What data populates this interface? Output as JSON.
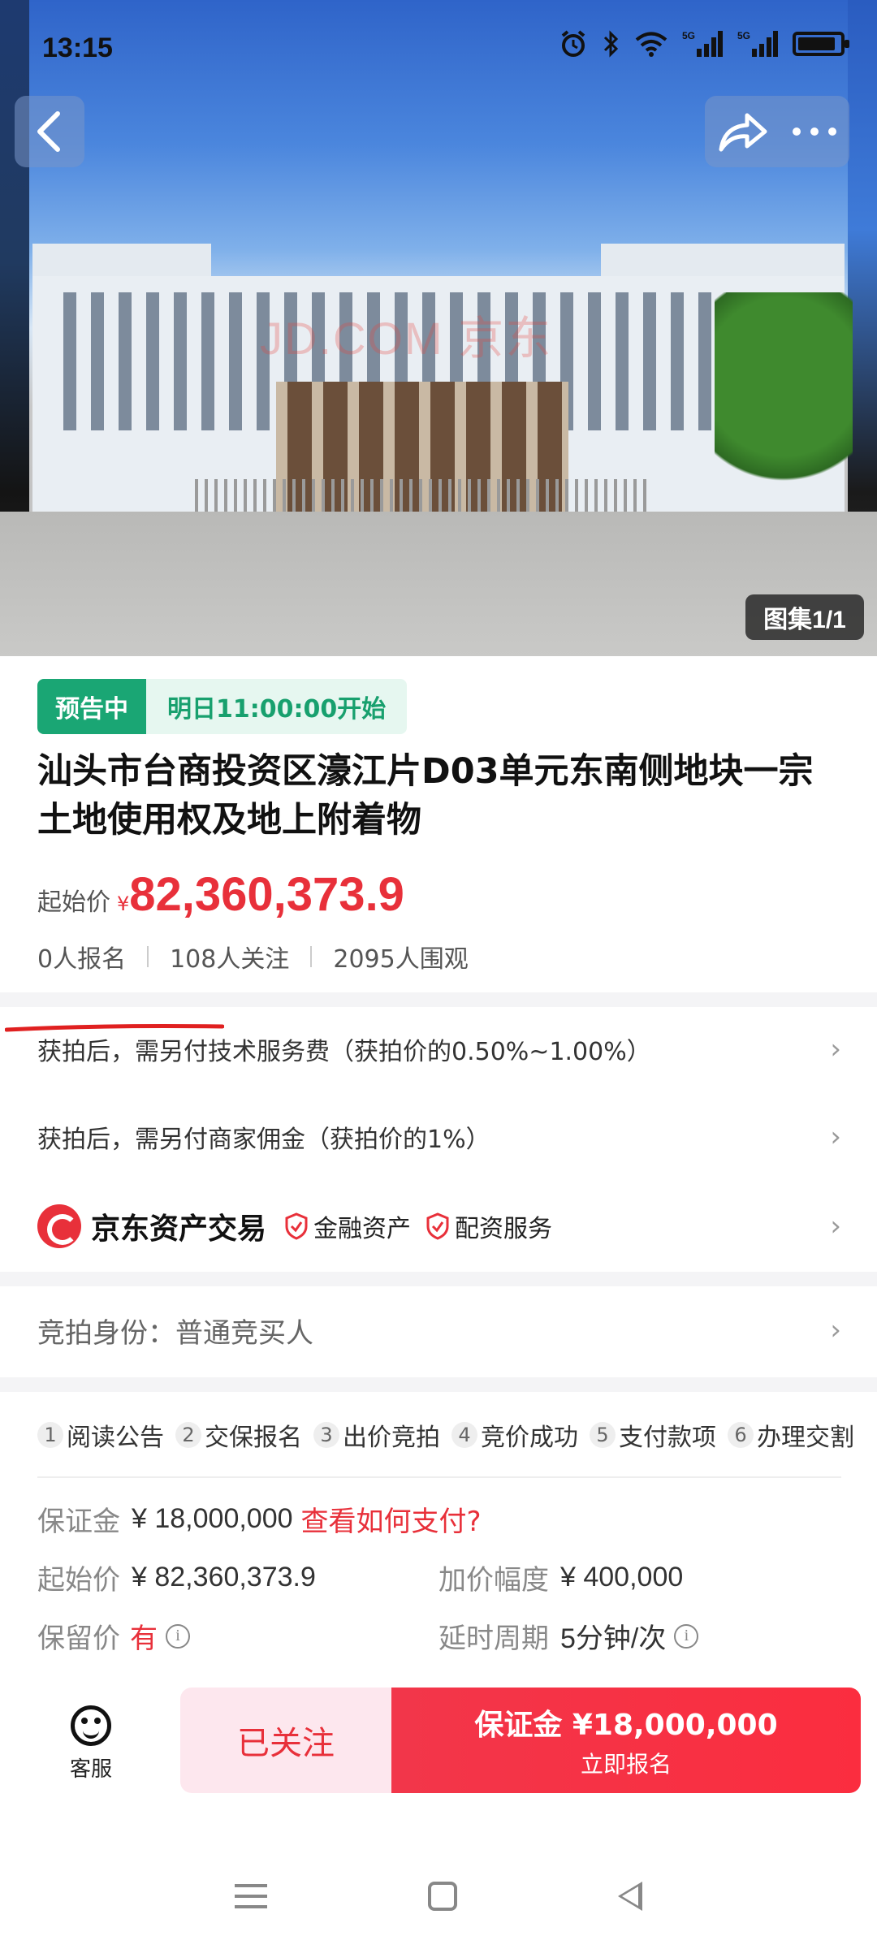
{
  "status_bar": {
    "time": "13:15",
    "battery_level": 0.9
  },
  "gallery": {
    "badge": "图集1/1",
    "watermark": "JD.COM 京东"
  },
  "auction": {
    "status_tag": "预告中",
    "start_time": "明日11:00:00开始",
    "title": "汕头市台商投资区濠江片D03单元东南侧地块一宗土地使用权及地上附着物",
    "price_label": "起始价",
    "price_currency": "¥",
    "price_value": "82,360,373.9",
    "stats": [
      "0人报名",
      "108人关注",
      "2095人围观"
    ]
  },
  "fees": [
    "获拍后，需另付技术服务费（获拍价的0.50%~1.00%）",
    "获拍后，需另付商家佣金（获拍价的1%）"
  ],
  "brand": {
    "name": "京东资产交易",
    "badges": [
      "金融资产",
      "配资服务"
    ]
  },
  "identity": {
    "text": "竞拍身份：普通竞买人"
  },
  "steps": [
    {
      "num": "1",
      "label": "阅读公告"
    },
    {
      "num": "2",
      "label": "交保报名"
    },
    {
      "num": "3",
      "label": "出价竞拍"
    },
    {
      "num": "4",
      "label": "竞价成功"
    },
    {
      "num": "5",
      "label": "支付款项"
    },
    {
      "num": "6",
      "label": "办理交割"
    }
  ],
  "details": {
    "deposit_label": "保证金",
    "deposit_value": "¥ 18,000,000",
    "deposit_link": "查看如何支付?",
    "start_label": "起始价",
    "start_value": "¥ 82,360,373.9",
    "increment_label": "加价幅度",
    "increment_value": "¥ 400,000",
    "reserve_label": "保留价",
    "reserve_value": "有",
    "delay_label": "延时周期",
    "delay_value": "5分钟/次"
  },
  "bottom_bar": {
    "service_label": "客服",
    "follow_label": "已关注",
    "register_main": "保证金 ¥18,000,000",
    "register_sub": "立即报名"
  },
  "colors": {
    "accent_red": "#e8303a",
    "status_green": "#1aa674"
  }
}
